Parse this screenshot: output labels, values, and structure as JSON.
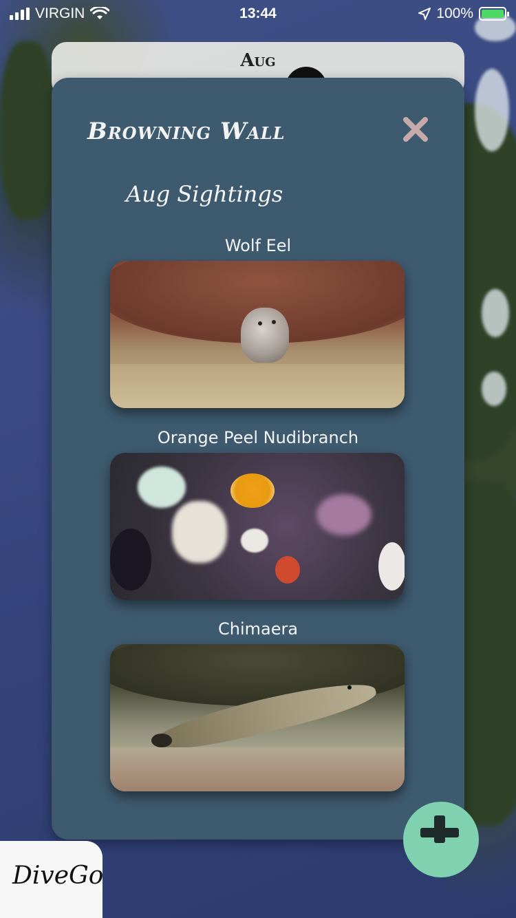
{
  "status_bar": {
    "carrier": "VIRGIN",
    "time": "13:44",
    "battery": "100%",
    "icons": [
      "signal-bars-icon",
      "wifi-icon",
      "location-arrow-icon",
      "battery-charging-icon"
    ]
  },
  "back_card": {
    "label": "Aug"
  },
  "modal": {
    "title": "Browning Wall",
    "subtitle": "Aug Sightings",
    "close_icon": "close-x-icon",
    "sightings": [
      {
        "name": "Wolf Eel"
      },
      {
        "name": "Orange Peel Nudibranch"
      },
      {
        "name": "Chimaera"
      }
    ]
  },
  "fab": {
    "icon": "plus-icon"
  },
  "logo": {
    "text": "DiveGo"
  },
  "colors": {
    "modal_bg": "#3e5a6f",
    "close_icon": "#c6a9a9",
    "fab_bg": "#7fd1b0",
    "logo_tab_bg": "#f7f7f7"
  }
}
